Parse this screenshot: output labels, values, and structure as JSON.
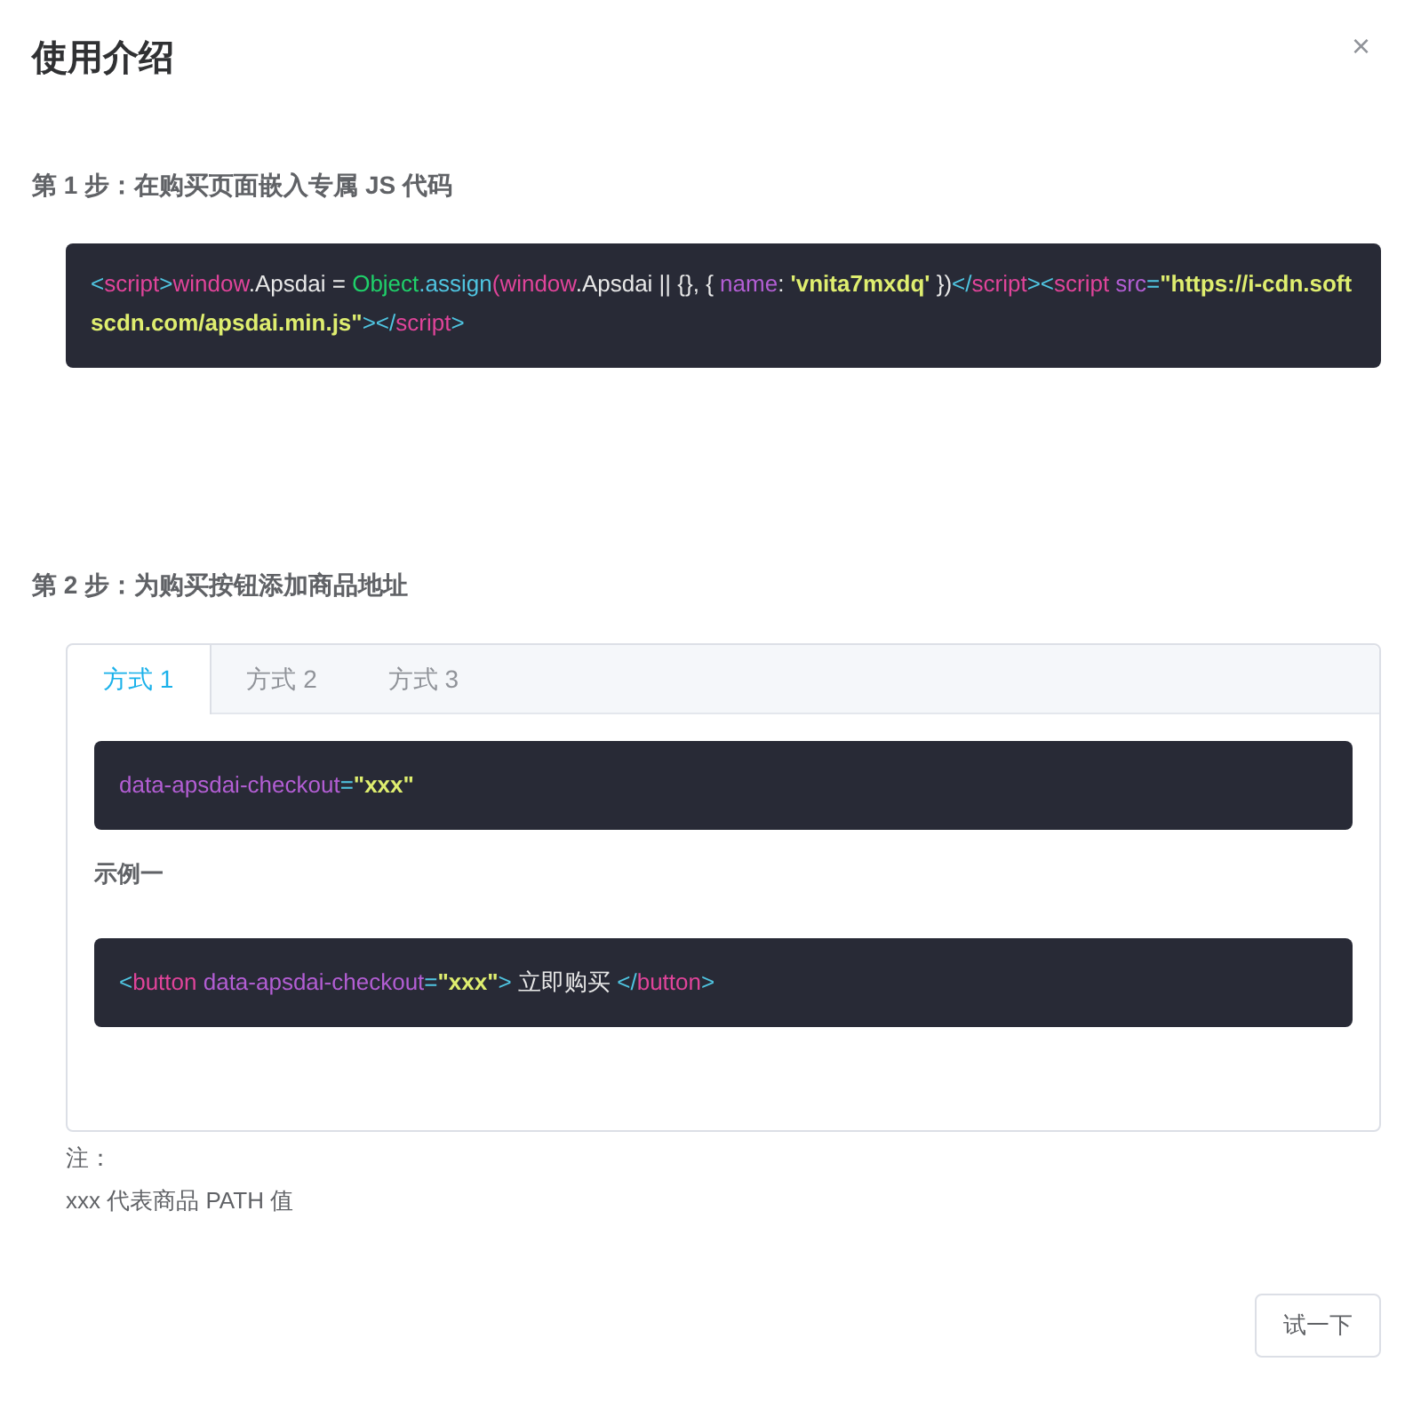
{
  "dialog": {
    "title": "使用介绍",
    "close": "×"
  },
  "steps": [
    {
      "heading": "第 1 步：在购买页面嵌入专属 JS 代码",
      "code": [
        {
          "kind": "punct",
          "text": "<"
        },
        {
          "kind": "tag",
          "text": "script"
        },
        {
          "kind": "punct",
          "text": ">"
        },
        {
          "kind": "tag",
          "text": "window"
        },
        {
          "kind": "plain",
          "text": ".Apsdai = "
        },
        {
          "kind": "class",
          "text": "Object"
        },
        {
          "kind": "func",
          "text": ".assign"
        },
        {
          "kind": "tag",
          "text": "(window"
        },
        {
          "kind": "plain",
          "text": ".Apsdai || {}, { "
        },
        {
          "kind": "attr",
          "text": "name"
        },
        {
          "kind": "plain",
          "text": ": "
        },
        {
          "kind": "string",
          "text": "'vnita7mxdq'"
        },
        {
          "kind": "plain",
          "text": " })"
        },
        {
          "kind": "punct",
          "text": "</"
        },
        {
          "kind": "tag",
          "text": "script"
        },
        {
          "kind": "punct",
          "text": ">"
        },
        {
          "kind": "punct",
          "text": "<"
        },
        {
          "kind": "tag",
          "text": "script"
        },
        {
          "kind": "attr",
          "text": " src"
        },
        {
          "kind": "punct",
          "text": "="
        },
        {
          "kind": "string",
          "text": "\"https://i-cdn.softscdn.com/apsdai.min.js\""
        },
        {
          "kind": "punct",
          "text": ">"
        },
        {
          "kind": "punct",
          "text": "</"
        },
        {
          "kind": "tag",
          "text": "script"
        },
        {
          "kind": "punct",
          "text": ">"
        }
      ]
    },
    {
      "heading": "第 2 步：为购买按钮添加商品地址",
      "tabs": [
        {
          "label": "方式 1",
          "selected": true
        },
        {
          "label": "方式 2",
          "selected": false
        },
        {
          "label": "方式 3",
          "selected": false
        }
      ],
      "panel": [
        {
          "kind": "code",
          "code": [
            {
              "kind": "attr",
              "text": "data-apsdai-checkout"
            },
            {
              "kind": "punct",
              "text": "="
            },
            {
              "kind": "string",
              "text": "\"xxx\""
            }
          ]
        },
        {
          "kind": "label",
          "text": "示例一"
        },
        {
          "kind": "code",
          "code": [
            {
              "kind": "punct",
              "text": "<"
            },
            {
              "kind": "tag",
              "text": "button"
            },
            {
              "kind": "attr",
              "text": " data-apsdai-checkout"
            },
            {
              "kind": "punct",
              "text": "="
            },
            {
              "kind": "string",
              "text": "\"xxx\""
            },
            {
              "kind": "punct",
              "text": ">"
            },
            {
              "kind": "plain",
              "text": " 立即购买 "
            },
            {
              "kind": "punct",
              "text": "</"
            },
            {
              "kind": "tag",
              "text": "button"
            },
            {
              "kind": "punct",
              "text": ">"
            }
          ]
        }
      ]
    }
  ],
  "notes": [
    "注：",
    "xxx 代表商品 PATH 值"
  ],
  "button": "试一下"
}
